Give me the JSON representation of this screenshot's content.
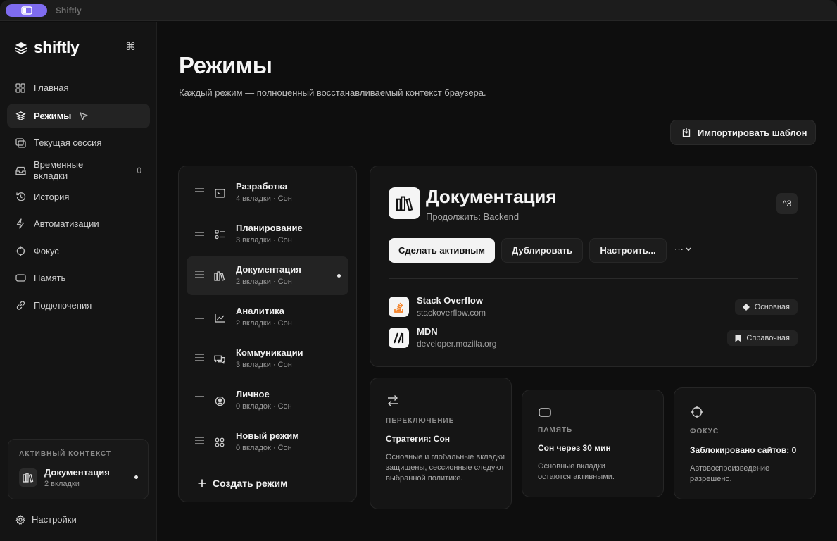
{
  "window": {
    "title": "Shiftly"
  },
  "sidebar": {
    "logo": "shiftly",
    "shortcut": "⌘",
    "items": [
      {
        "label": "Главная",
        "icon": "grid-icon"
      },
      {
        "label": "Режимы",
        "icon": "layers-icon",
        "active": true
      },
      {
        "label": "Текущая сессия",
        "icon": "windows-icon"
      },
      {
        "label": "Временные вкладки",
        "icon": "tray-icon",
        "count": "0"
      },
      {
        "label": "История",
        "icon": "history-icon"
      },
      {
        "label": "Автоматизации",
        "icon": "bolt-icon"
      },
      {
        "label": "Фокус",
        "icon": "crosshair-icon"
      },
      {
        "label": "Память",
        "icon": "memory-icon"
      },
      {
        "label": "Подключения",
        "icon": "link-icon"
      }
    ],
    "active_context": {
      "label": "АКТИВНЫЙ КОНТЕКСТ",
      "title": "Документация",
      "subtitle": "2 вкладки"
    },
    "settings": "Настройки"
  },
  "main": {
    "title": "Режимы",
    "subtitle": "Каждый режим — полноценный восстанавливаемый контекст браузера.",
    "import_label": "Импортировать шаблон"
  },
  "modes": {
    "items": [
      {
        "name": "Разработка",
        "meta": "4 вкладки · Сон",
        "icon": "terminal-icon"
      },
      {
        "name": "Планирование",
        "meta": "3 вкладки · Сон",
        "icon": "checklist-icon"
      },
      {
        "name": "Документация",
        "meta": "2 вкладки · Сон",
        "icon": "books-icon",
        "selected": true
      },
      {
        "name": "Аналитика",
        "meta": "2 вкладки · Сон",
        "icon": "chart-icon"
      },
      {
        "name": "Коммуникации",
        "meta": "3 вкладки · Сон",
        "icon": "chat-icon"
      },
      {
        "name": "Личное",
        "meta": "0 вкладок · Сон",
        "icon": "user-icon"
      },
      {
        "name": "Новый режим",
        "meta": "0 вкладок · Сон",
        "icon": "apps-icon"
      }
    ],
    "create_label": "Создать режим"
  },
  "detail": {
    "title": "Документация",
    "subtitle": "Продолжить: Backend",
    "shortcut": "^3",
    "buttons": {
      "activate": "Сделать активным",
      "duplicate": "Дублировать",
      "configure": "Настроить...",
      "more": "···"
    },
    "sites": [
      {
        "name": "Stack Overflow",
        "url": "stackoverflow.com",
        "badge": "Основная",
        "badge_icon": "diamond-icon"
      },
      {
        "name": "MDN",
        "url": "developer.mozilla.org",
        "badge": "Справочная",
        "badge_icon": "bookmark-icon"
      }
    ]
  },
  "cards": [
    {
      "label": "ПЕРЕКЛЮЧЕНИЕ",
      "title": "Стратегия: Сон",
      "text": "Основные и глобальные вкладки защищены, сессионные следуют выбранной политике.",
      "icon": "swap-icon"
    },
    {
      "label": "ПАМЯТЬ",
      "title": "Сон через 30 мин",
      "text": "Основные вкладки остаются активными.",
      "icon": "memory-icon"
    },
    {
      "label": "ФОКУС",
      "title": "Заблокировано сайтов: 0",
      "text": "Автовоспроизведение разрешено.",
      "icon": "crosshair-icon"
    }
  ],
  "colors": {
    "accent": "#7f6cf0",
    "background": "#0e0e0e",
    "panel": "#151515",
    "primary_button": "#f3f3f3"
  }
}
